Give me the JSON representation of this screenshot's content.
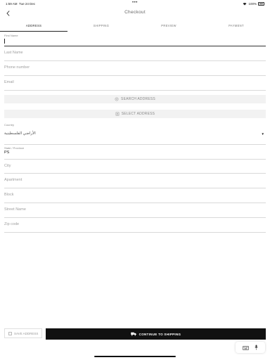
{
  "status_bar": {
    "time": "1:59 AM",
    "date": "Tue 24 Dec",
    "dots": "•••",
    "battery": "100%"
  },
  "header": {
    "title": "Checkout"
  },
  "steps": [
    {
      "label": "ADDRESS",
      "active": true
    },
    {
      "label": "SHIPPING",
      "active": false
    },
    {
      "label": "PREVIEW",
      "active": false
    },
    {
      "label": "PAYMENT",
      "active": false
    }
  ],
  "form": {
    "first_name": {
      "label": "First Name",
      "value": ""
    },
    "last_name": {
      "placeholder": "Last Name"
    },
    "phone": {
      "placeholder": "Phone number"
    },
    "email": {
      "placeholder": "Email"
    },
    "search_address": "SEARCH ADDRESS",
    "select_address": "SELECT ADDRESS",
    "country": {
      "label": "Country",
      "value": "الأراضي الفلسطينية"
    },
    "state": {
      "label": "State / Province",
      "value": "PS"
    },
    "city": {
      "placeholder": "City"
    },
    "apartment": {
      "placeholder": "Apartment"
    },
    "block": {
      "placeholder": "Block"
    },
    "street": {
      "placeholder": "Street Name"
    },
    "zip": {
      "placeholder": "Zip code"
    }
  },
  "footer": {
    "save_address": "SAVE ADDRESS",
    "continue": "CONTINUE TO SHIPPING"
  },
  "colors": {
    "primary": "#111111",
    "muted_text": "#a0a0a0",
    "divider": "#d9d9d9",
    "button_bg": "#f2f2f2"
  }
}
